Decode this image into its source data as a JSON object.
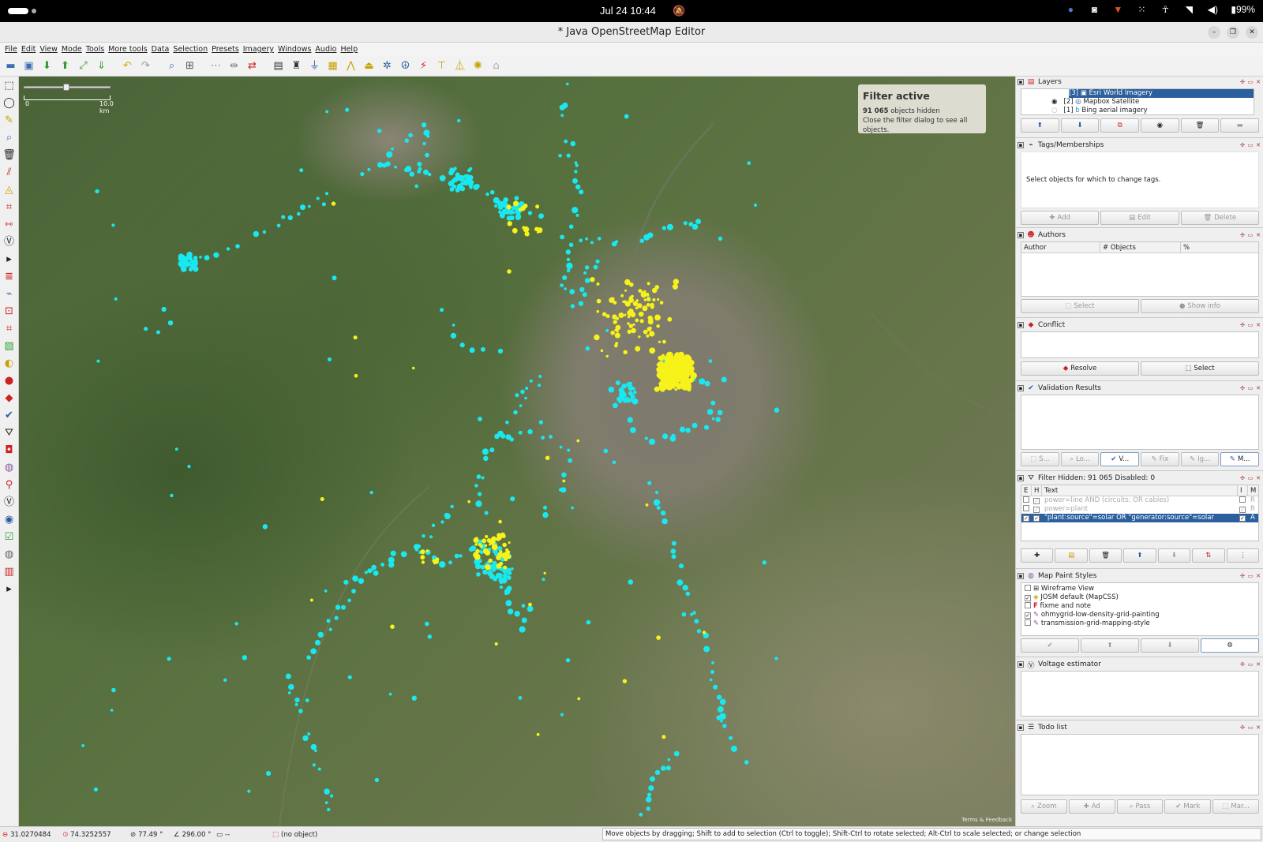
{
  "system_bar": {
    "clock": "Jul 24  10:44",
    "battery": "99%"
  },
  "window": {
    "title": "* Java OpenStreetMap Editor"
  },
  "menu": [
    "File",
    "Edit",
    "View",
    "Mode",
    "Tools",
    "More tools",
    "Data",
    "Selection",
    "Presets",
    "Imagery",
    "Windows",
    "Audio",
    "Help"
  ],
  "map": {
    "scale_start": "0",
    "scale_end": "10.0 km",
    "filter_title": "Filter active",
    "filter_count": "91 065",
    "filter_count_suffix": " objects hidden",
    "filter_hint": "Close the filter dialog to see all objects.",
    "attribution": "Terms & Feedback",
    "colors": {
      "powerline": "#19e8f0",
      "solar": "#f6f21a"
    }
  },
  "layers": {
    "title": "Layers",
    "items": [
      {
        "index": "[3]",
        "name": "Esri World Imagery",
        "selected": true
      },
      {
        "index": "[2]",
        "name": "Mapbox Satellite",
        "selected": false
      },
      {
        "index": "[1]",
        "name": "Bing aerial imagery",
        "selected": false
      }
    ]
  },
  "tags": {
    "title": "Tags/Memberships",
    "empty": "Select objects for which to change tags.",
    "add": "Add",
    "edit": "Edit",
    "delete": "Delete"
  },
  "authors": {
    "title": "Authors",
    "col_author": "Author",
    "col_objects": "# Objects",
    "col_percent": "%",
    "select": "Select",
    "show_info": "Show info"
  },
  "conflict": {
    "title": "Conflict",
    "resolve": "Resolve",
    "select": "Select"
  },
  "validation": {
    "title": "Validation Results",
    "buttons": [
      "S...",
      "Lo...",
      "V...",
      "Fix",
      "Ig...",
      "M..."
    ]
  },
  "filter": {
    "title": "Filter Hidden: 91 065 Disabled: 0",
    "col_e": "E",
    "col_h": "H",
    "col_text": "Text",
    "col_i": "I",
    "col_m": "M",
    "rows": [
      {
        "text": "power=line AND (circuits: OR cables)",
        "mode": "R",
        "enabled": false
      },
      {
        "text": "power=plant",
        "mode": "R",
        "enabled": false
      },
      {
        "text": "\"plant:source\"=solar OR \"generator:source\"=solar",
        "mode": "A",
        "enabled": true
      }
    ]
  },
  "paint_styles": {
    "title": "Map Paint Styles",
    "items": [
      {
        "name": "Wireframe View",
        "checked": false
      },
      {
        "name": "JOSM default (MapCSS)",
        "checked": true
      },
      {
        "name": "fixme and note",
        "checked": false
      },
      {
        "name": "ohmygrid-low-density-grid-painting",
        "checked": true
      },
      {
        "name": "transmission-grid-mapping-style",
        "checked": false
      }
    ]
  },
  "voltage": {
    "title": "Voltage estimator"
  },
  "todo": {
    "title": "Todo list",
    "buttons": [
      "Zoom",
      "Ad",
      "Pass",
      "Mark",
      "Mar..."
    ]
  },
  "status": {
    "lat": "31.0270484",
    "lon": "74.3252557",
    "heading": "77.49 °",
    "angle": "296.00 °",
    "dist": "--",
    "object": "(no object)",
    "help": "Move objects by dragging; Shift to add to selection (Ctrl to toggle); Shift-Ctrl to rotate selected; Alt-Ctrl to scale selected; or change selection"
  }
}
